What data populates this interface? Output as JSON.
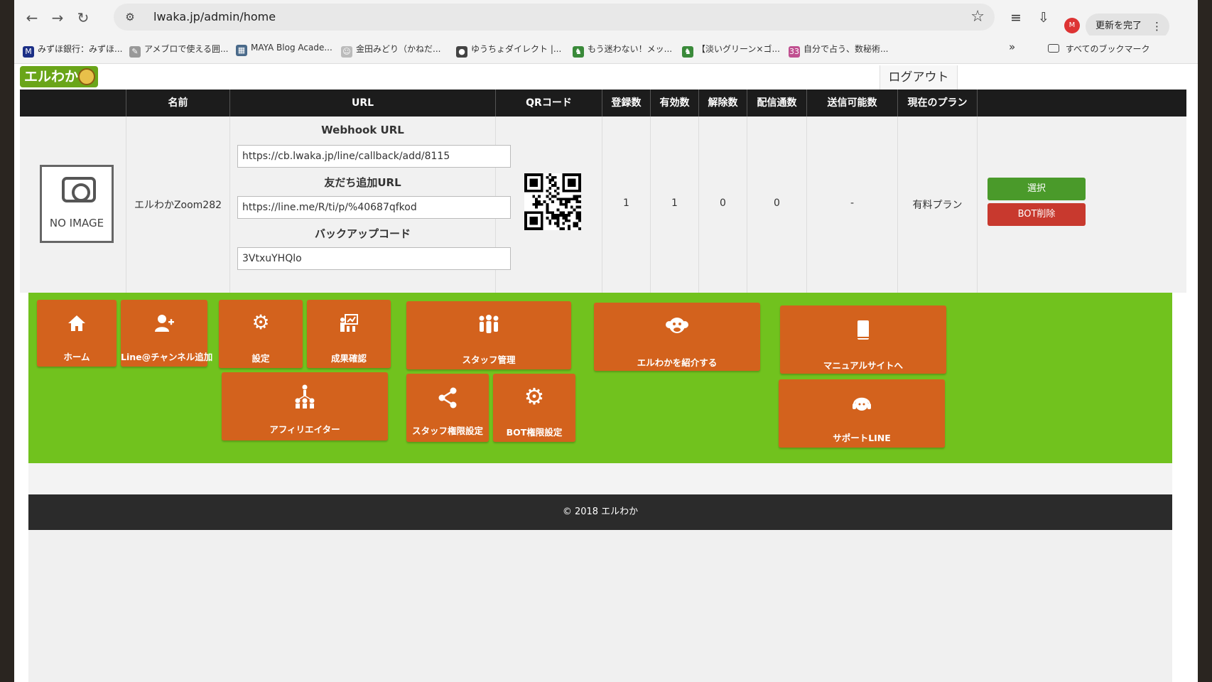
{
  "browser": {
    "url": "lwaka.jp/admin/home",
    "update_label": "更新を完了",
    "profile_initial": "M",
    "bookmarks": [
      {
        "label": "みずほ銀行：みずほ...",
        "icon": "M",
        "color": "#1b2f86"
      },
      {
        "label": "アメブロで使える囲...",
        "icon": "✎",
        "color": "#999999"
      },
      {
        "label": "MAYA Blog Acade...",
        "icon": "▦",
        "color": "#4a6a8a"
      },
      {
        "label": "金田みどり（かねだ...",
        "icon": "☺",
        "color": "#bbbbbb"
      },
      {
        "label": "ゆうちょダイレクト |...",
        "icon": "●",
        "color": "#444444"
      },
      {
        "label": "もう迷わない！メッ...",
        "icon": "♞",
        "color": "#3a8a3a"
      },
      {
        "label": "【淡いグリーン×ゴ...",
        "icon": "♞",
        "color": "#3a8a3a"
      },
      {
        "label": "自分で占う、数秘術...",
        "icon": "33",
        "color": "#c05090"
      }
    ],
    "more_label": "»",
    "all_bookmarks_label": "すべてのブックマーク"
  },
  "header": {
    "logo_text": "エルわか",
    "logout_label": "ログアウト"
  },
  "table": {
    "headers": {
      "name": "名前",
      "url": "URL",
      "qr": "QRコード",
      "registered": "登録数",
      "valid": "有効数",
      "cancelled": "解除数",
      "delivered": "配信通数",
      "sendable": "送信可能数",
      "plan": "現在のプラン"
    },
    "row": {
      "image_label": "NO IMAGE",
      "name": "エルわかZoom282",
      "webhook_title": "Webhook URL",
      "webhook_url": "https://cb.lwaka.jp/line/callback/add/8115",
      "friend_title": "友だち追加URL",
      "friend_url": "https://line.me/R/ti/p/%40687qfkod",
      "backup_title": "バックアップコード",
      "backup_code": "3VtxuYHQlo",
      "registered": "1",
      "valid": "1",
      "cancelled": "0",
      "delivered": "0",
      "sendable": "-",
      "plan": "有料プラン",
      "select_label": "選択",
      "delete_label": "BOT削除"
    }
  },
  "menu": {
    "home": "ホーム",
    "add_channel": "Line@チャンネル追加",
    "settings": "設定",
    "results": "成果確認",
    "staff": "スタッフ管理",
    "introduce": "エルわかを紹介する",
    "manual": "マニュアルサイトへ",
    "affiliate": "アフィリエイター",
    "staff_permissions": "スタッフ権限設定",
    "bot_permissions": "BOT権限設定",
    "support": "サポートLINE"
  },
  "footer": {
    "copyright": "© 2018 エルわか"
  },
  "colors": {
    "green_band": "#71c21e",
    "tile": "#d3621d",
    "select_button": "#4a9a2a",
    "delete_button": "#c8392e"
  }
}
